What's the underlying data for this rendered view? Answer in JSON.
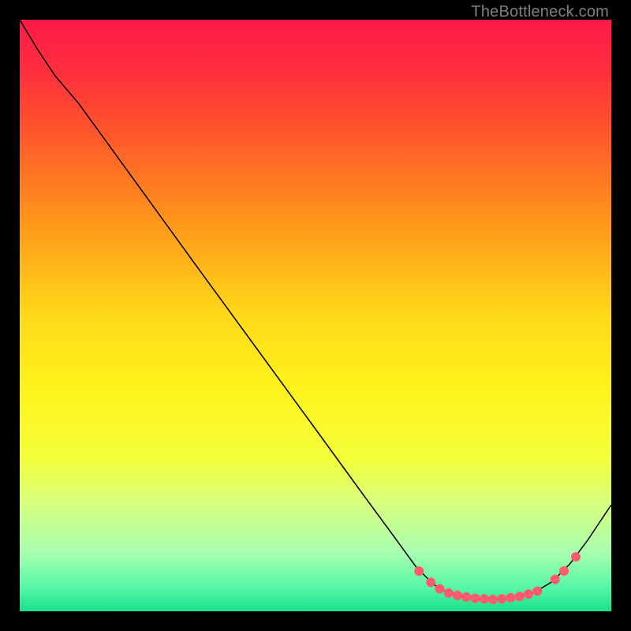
{
  "attribution": "TheBottleneck.com",
  "chart_data": {
    "type": "line",
    "title": "",
    "xlabel": "",
    "ylabel": "",
    "xlim": [
      0,
      100
    ],
    "ylim": [
      0,
      100
    ],
    "background_gradient": {
      "stops": [
        {
          "offset": 0.0,
          "color": "#ff1a49"
        },
        {
          "offset": 0.08,
          "color": "#ff2c3f"
        },
        {
          "offset": 0.2,
          "color": "#ff5a2a"
        },
        {
          "offset": 0.35,
          "color": "#ff9a1a"
        },
        {
          "offset": 0.5,
          "color": "#ffd91a"
        },
        {
          "offset": 0.62,
          "color": "#fff21c"
        },
        {
          "offset": 0.74,
          "color": "#f4ff3a"
        },
        {
          "offset": 0.82,
          "color": "#d6ff80"
        },
        {
          "offset": 0.9,
          "color": "#a8ffb0"
        },
        {
          "offset": 0.96,
          "color": "#56f7a6"
        },
        {
          "offset": 1.0,
          "color": "#19e08a"
        }
      ]
    },
    "series": [
      {
        "name": "curve",
        "color": "#000000",
        "width": 1.5,
        "points": [
          {
            "x": 0.0,
            "y": 100.0
          },
          {
            "x": 3.0,
            "y": 95.0
          },
          {
            "x": 6.0,
            "y": 90.5
          },
          {
            "x": 10.0,
            "y": 85.8
          },
          {
            "x": 20.0,
            "y": 72.0
          },
          {
            "x": 30.0,
            "y": 58.2
          },
          {
            "x": 40.0,
            "y": 44.5
          },
          {
            "x": 50.0,
            "y": 30.8
          },
          {
            "x": 58.0,
            "y": 19.8
          },
          {
            "x": 63.0,
            "y": 13.0
          },
          {
            "x": 67.0,
            "y": 7.5
          },
          {
            "x": 70.0,
            "y": 4.5
          },
          {
            "x": 73.0,
            "y": 2.8
          },
          {
            "x": 76.0,
            "y": 2.2
          },
          {
            "x": 80.0,
            "y": 2.0
          },
          {
            "x": 84.0,
            "y": 2.4
          },
          {
            "x": 87.0,
            "y": 3.2
          },
          {
            "x": 90.0,
            "y": 5.0
          },
          {
            "x": 93.0,
            "y": 8.0
          },
          {
            "x": 96.0,
            "y": 12.0
          },
          {
            "x": 100.0,
            "y": 18.0
          }
        ]
      }
    ],
    "markers": {
      "name": "valley-dots",
      "color": "#ff5a6e",
      "radius": 6,
      "points": [
        {
          "x": 67.5,
          "y": 6.8
        },
        {
          "x": 69.5,
          "y": 4.9
        },
        {
          "x": 71.0,
          "y": 3.8
        },
        {
          "x": 72.5,
          "y": 3.1
        },
        {
          "x": 74.0,
          "y": 2.7
        },
        {
          "x": 75.5,
          "y": 2.4
        },
        {
          "x": 77.0,
          "y": 2.2
        },
        {
          "x": 78.5,
          "y": 2.1
        },
        {
          "x": 80.0,
          "y": 2.0
        },
        {
          "x": 81.5,
          "y": 2.1
        },
        {
          "x": 83.0,
          "y": 2.3
        },
        {
          "x": 84.5,
          "y": 2.5
        },
        {
          "x": 86.0,
          "y": 2.9
        },
        {
          "x": 87.5,
          "y": 3.4
        },
        {
          "x": 90.5,
          "y": 5.4
        },
        {
          "x": 92.0,
          "y": 6.8
        },
        {
          "x": 94.0,
          "y": 9.2
        }
      ]
    }
  }
}
